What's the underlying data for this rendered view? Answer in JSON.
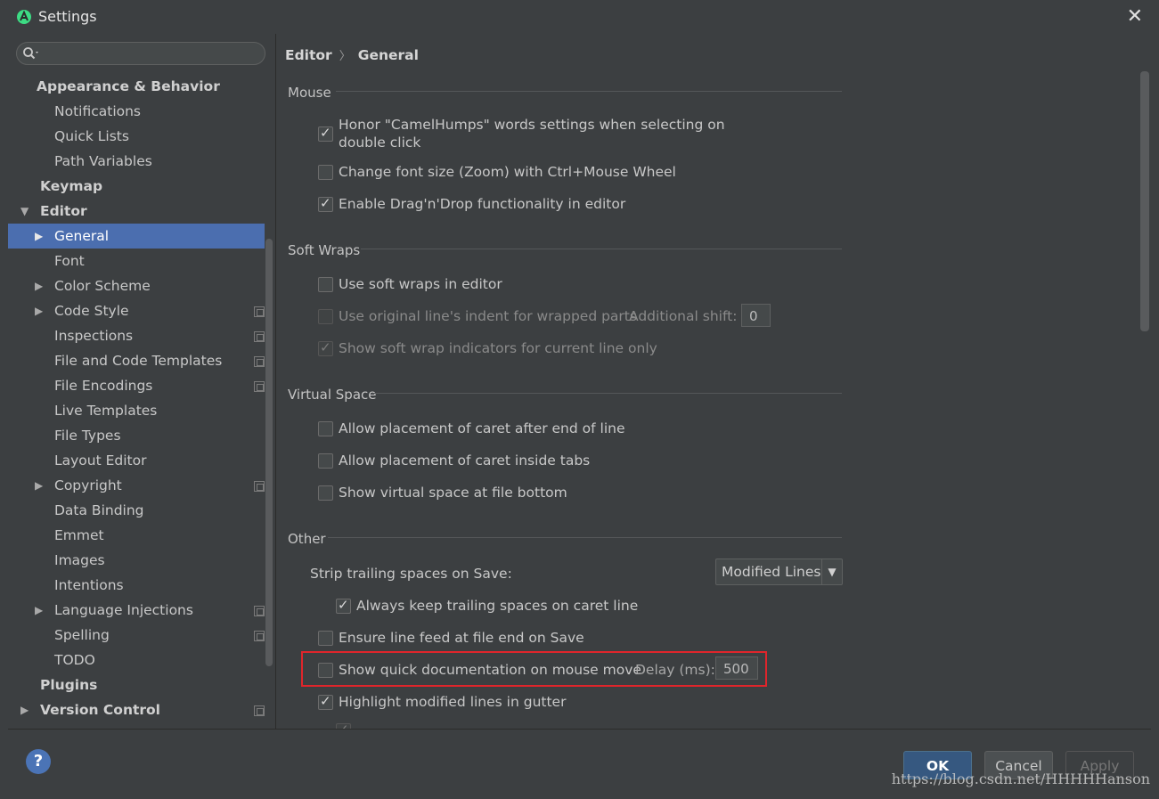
{
  "window": {
    "title": "Settings",
    "close_glyph": "✕"
  },
  "search": {
    "placeholder": ""
  },
  "sidebar": {
    "items": [
      {
        "label": "Appearance & Behavior",
        "level": 0,
        "bold": true,
        "arrow": "",
        "proj": false
      },
      {
        "label": "Notifications",
        "level": 1,
        "bold": false,
        "arrow": "",
        "proj": false
      },
      {
        "label": "Quick Lists",
        "level": 1,
        "bold": false,
        "arrow": "",
        "proj": false
      },
      {
        "label": "Path Variables",
        "level": 1,
        "bold": false,
        "arrow": "",
        "proj": false
      },
      {
        "label": "Keymap",
        "level": 0,
        "bold": true,
        "arrow": "",
        "proj": false
      },
      {
        "label": "Editor",
        "level": 0,
        "bold": true,
        "arrow": "▼",
        "proj": false
      },
      {
        "label": "General",
        "level": 1,
        "bold": false,
        "arrow": "▶",
        "proj": false,
        "selected": true
      },
      {
        "label": "Font",
        "level": 1,
        "bold": false,
        "arrow": "",
        "proj": false
      },
      {
        "label": "Color Scheme",
        "level": 1,
        "bold": false,
        "arrow": "▶",
        "proj": false
      },
      {
        "label": "Code Style",
        "level": 1,
        "bold": false,
        "arrow": "▶",
        "proj": true
      },
      {
        "label": "Inspections",
        "level": 1,
        "bold": false,
        "arrow": "",
        "proj": true
      },
      {
        "label": "File and Code Templates",
        "level": 1,
        "bold": false,
        "arrow": "",
        "proj": true
      },
      {
        "label": "File Encodings",
        "level": 1,
        "bold": false,
        "arrow": "",
        "proj": true
      },
      {
        "label": "Live Templates",
        "level": 1,
        "bold": false,
        "arrow": "",
        "proj": false
      },
      {
        "label": "File Types",
        "level": 1,
        "bold": false,
        "arrow": "",
        "proj": false
      },
      {
        "label": "Layout Editor",
        "level": 1,
        "bold": false,
        "arrow": "",
        "proj": false
      },
      {
        "label": "Copyright",
        "level": 1,
        "bold": false,
        "arrow": "▶",
        "proj": true
      },
      {
        "label": "Data Binding",
        "level": 1,
        "bold": false,
        "arrow": "",
        "proj": false
      },
      {
        "label": "Emmet",
        "level": 1,
        "bold": false,
        "arrow": "",
        "proj": false
      },
      {
        "label": "Images",
        "level": 1,
        "bold": false,
        "arrow": "",
        "proj": false
      },
      {
        "label": "Intentions",
        "level": 1,
        "bold": false,
        "arrow": "",
        "proj": false
      },
      {
        "label": "Language Injections",
        "level": 1,
        "bold": false,
        "arrow": "▶",
        "proj": true
      },
      {
        "label": "Spelling",
        "level": 1,
        "bold": false,
        "arrow": "",
        "proj": true
      },
      {
        "label": "TODO",
        "level": 1,
        "bold": false,
        "arrow": "",
        "proj": false
      },
      {
        "label": "Plugins",
        "level": 0,
        "bold": true,
        "arrow": "",
        "proj": false
      },
      {
        "label": "Version Control",
        "level": 0,
        "bold": true,
        "arrow": "▶",
        "proj": true
      }
    ]
  },
  "breadcrumb": {
    "parent": "Editor",
    "separator": "〉",
    "current": "General"
  },
  "mouse": {
    "title": "Mouse",
    "camelhumps_line1": "Honor \"CamelHumps\" words settings when selecting on",
    "camelhumps_line2": "double click",
    "zoom": "Change font size (Zoom) with Ctrl+Mouse Wheel",
    "dragdrop": "Enable Drag'n'Drop functionality in editor"
  },
  "softwraps": {
    "title": "Soft Wraps",
    "use": "Use soft wraps in editor",
    "indent": "Use original line's indent for wrapped parts",
    "shift_label": "Additional shift:",
    "shift_value": "0",
    "indicators": "Show soft wrap indicators for current line only"
  },
  "virtual": {
    "title": "Virtual Space",
    "after_end": "Allow placement of caret after end of line",
    "inside_tabs": "Allow placement of caret inside tabs",
    "file_bottom": "Show virtual space at file bottom"
  },
  "other": {
    "title": "Other",
    "strip_label": "Strip trailing spaces on Save:",
    "strip_value": "Modified Lines",
    "keep_trailing": "Always keep trailing spaces on caret line",
    "line_feed": "Ensure line feed at file end on Save",
    "quick_doc": "Show quick documentation on mouse move",
    "delay_label": "Delay (ms):",
    "delay_value": "500",
    "highlight_modified": "Highlight modified lines in gutter"
  },
  "buttons": {
    "help": "?",
    "ok": "OK",
    "cancel": "Cancel",
    "apply": "Apply"
  },
  "watermark": "https://blog.csdn.net/HHHHHanson",
  "colors": {
    "selection": "#4b6eaf",
    "highlight_box": "#e0252b",
    "ok_button": "#365880"
  }
}
